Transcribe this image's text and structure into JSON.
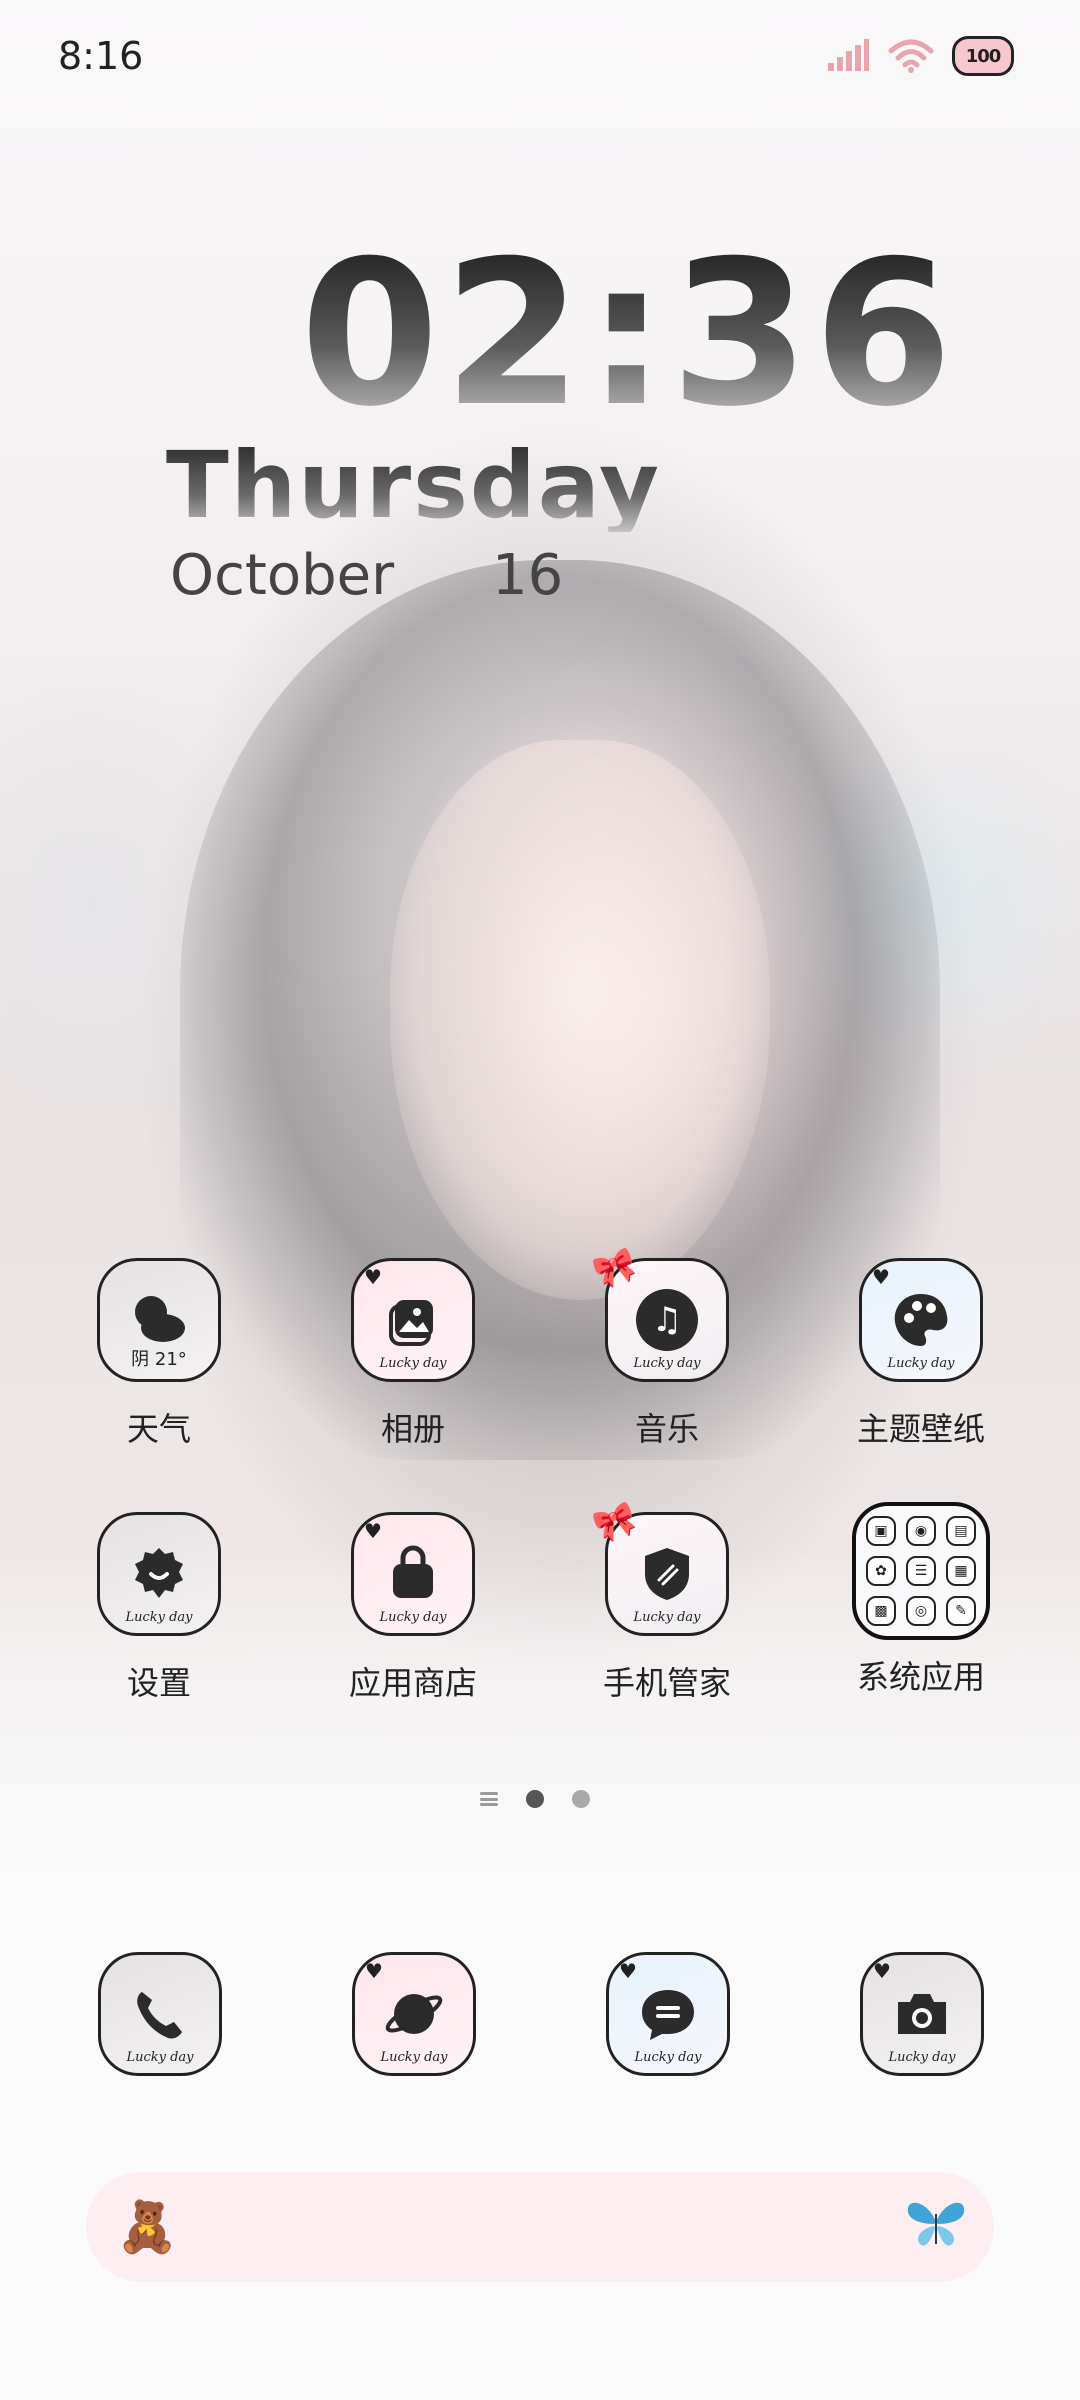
{
  "status_bar": {
    "time": "8:16",
    "icons": [
      "signal-icon",
      "wifi-icon",
      "battery-icon"
    ],
    "battery_text": "100"
  },
  "clock_widget": {
    "time": "02:36",
    "day": "Thursday",
    "month": "October",
    "date": "16"
  },
  "apps": [
    {
      "label": "天气",
      "icon": "weather-icon",
      "sub": "阴 21°"
    },
    {
      "label": "相册",
      "icon": "gallery-icon",
      "sub": "Lucky day"
    },
    {
      "label": "音乐",
      "icon": "music-icon",
      "sub": "Lucky day"
    },
    {
      "label": "主题壁纸",
      "icon": "palette-icon",
      "sub": "Lucky day"
    },
    {
      "label": "设置",
      "icon": "gear-icon",
      "sub": "Lucky day"
    },
    {
      "label": "应用商店",
      "icon": "shopping-bag-icon",
      "sub": "Lucky day"
    },
    {
      "label": "手机管家",
      "icon": "shield-icon",
      "sub": "Lucky day"
    },
    {
      "label": "系统应用",
      "icon": "folder-icon"
    }
  ],
  "dock": [
    {
      "icon": "phone-icon",
      "sub": "Lucky day"
    },
    {
      "icon": "browser-planet-icon",
      "sub": "Lucky day"
    },
    {
      "icon": "messages-icon",
      "sub": "Lucky day"
    },
    {
      "icon": "camera-icon",
      "sub": "Lucky day"
    }
  ],
  "page_indicator": {
    "pages": 2,
    "current": 1
  },
  "search_bar": {
    "left_icon": "teddy-bear-icon",
    "right_icon": "butterfly-icon"
  }
}
